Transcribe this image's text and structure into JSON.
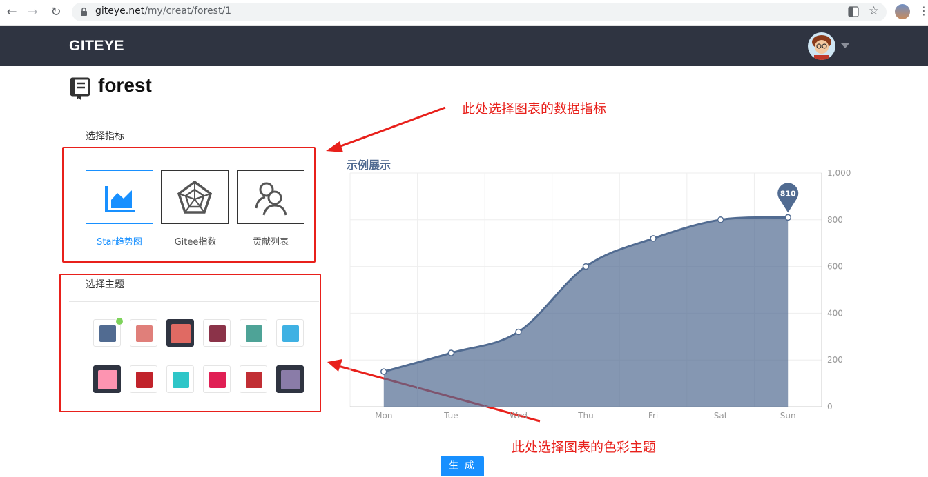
{
  "browser": {
    "url_host": "giteye.net",
    "url_path": "/my/creat/forest/1"
  },
  "header": {
    "brand": "GITEYE"
  },
  "repo": {
    "title": "forest"
  },
  "metrics": {
    "label": "选择指标",
    "items": [
      {
        "label": "Star趋势图",
        "icon": "area-chart-icon",
        "selected": true
      },
      {
        "label": "Gitee指数",
        "icon": "radar-chart-icon",
        "selected": false
      },
      {
        "label": "贡献列表",
        "icon": "users-icon",
        "selected": false
      }
    ]
  },
  "themes": {
    "label": "选择主题",
    "selected_index": 0,
    "colors": [
      "#516b91",
      "#e07f7a",
      "#e06a63",
      "#8b3349",
      "#4ea397",
      "#3fb1e3",
      "#fd94b1",
      "#c1232b",
      "#2ec6c8",
      "#e01f54",
      "#c12e34",
      "#8a7ca8"
    ]
  },
  "annotations": {
    "metrics_note": "此处选择图表的数据指标",
    "theme_note": "此处选择图表的色彩主题"
  },
  "preview": {
    "title": "示例展示"
  },
  "generate_button": "生 成",
  "chart_data": {
    "type": "area",
    "categories": [
      "Mon",
      "Tue",
      "Wed",
      "Thu",
      "Fri",
      "Sat",
      "Sun"
    ],
    "values": [
      150,
      230,
      320,
      600,
      720,
      800,
      810
    ],
    "y_ticks": [
      "0",
      "200",
      "400",
      "600",
      "800",
      "1,000"
    ],
    "ylim": [
      0,
      1000
    ],
    "y_axis_position": "right",
    "max_label": "810",
    "color": "#516b91",
    "grid": true
  }
}
